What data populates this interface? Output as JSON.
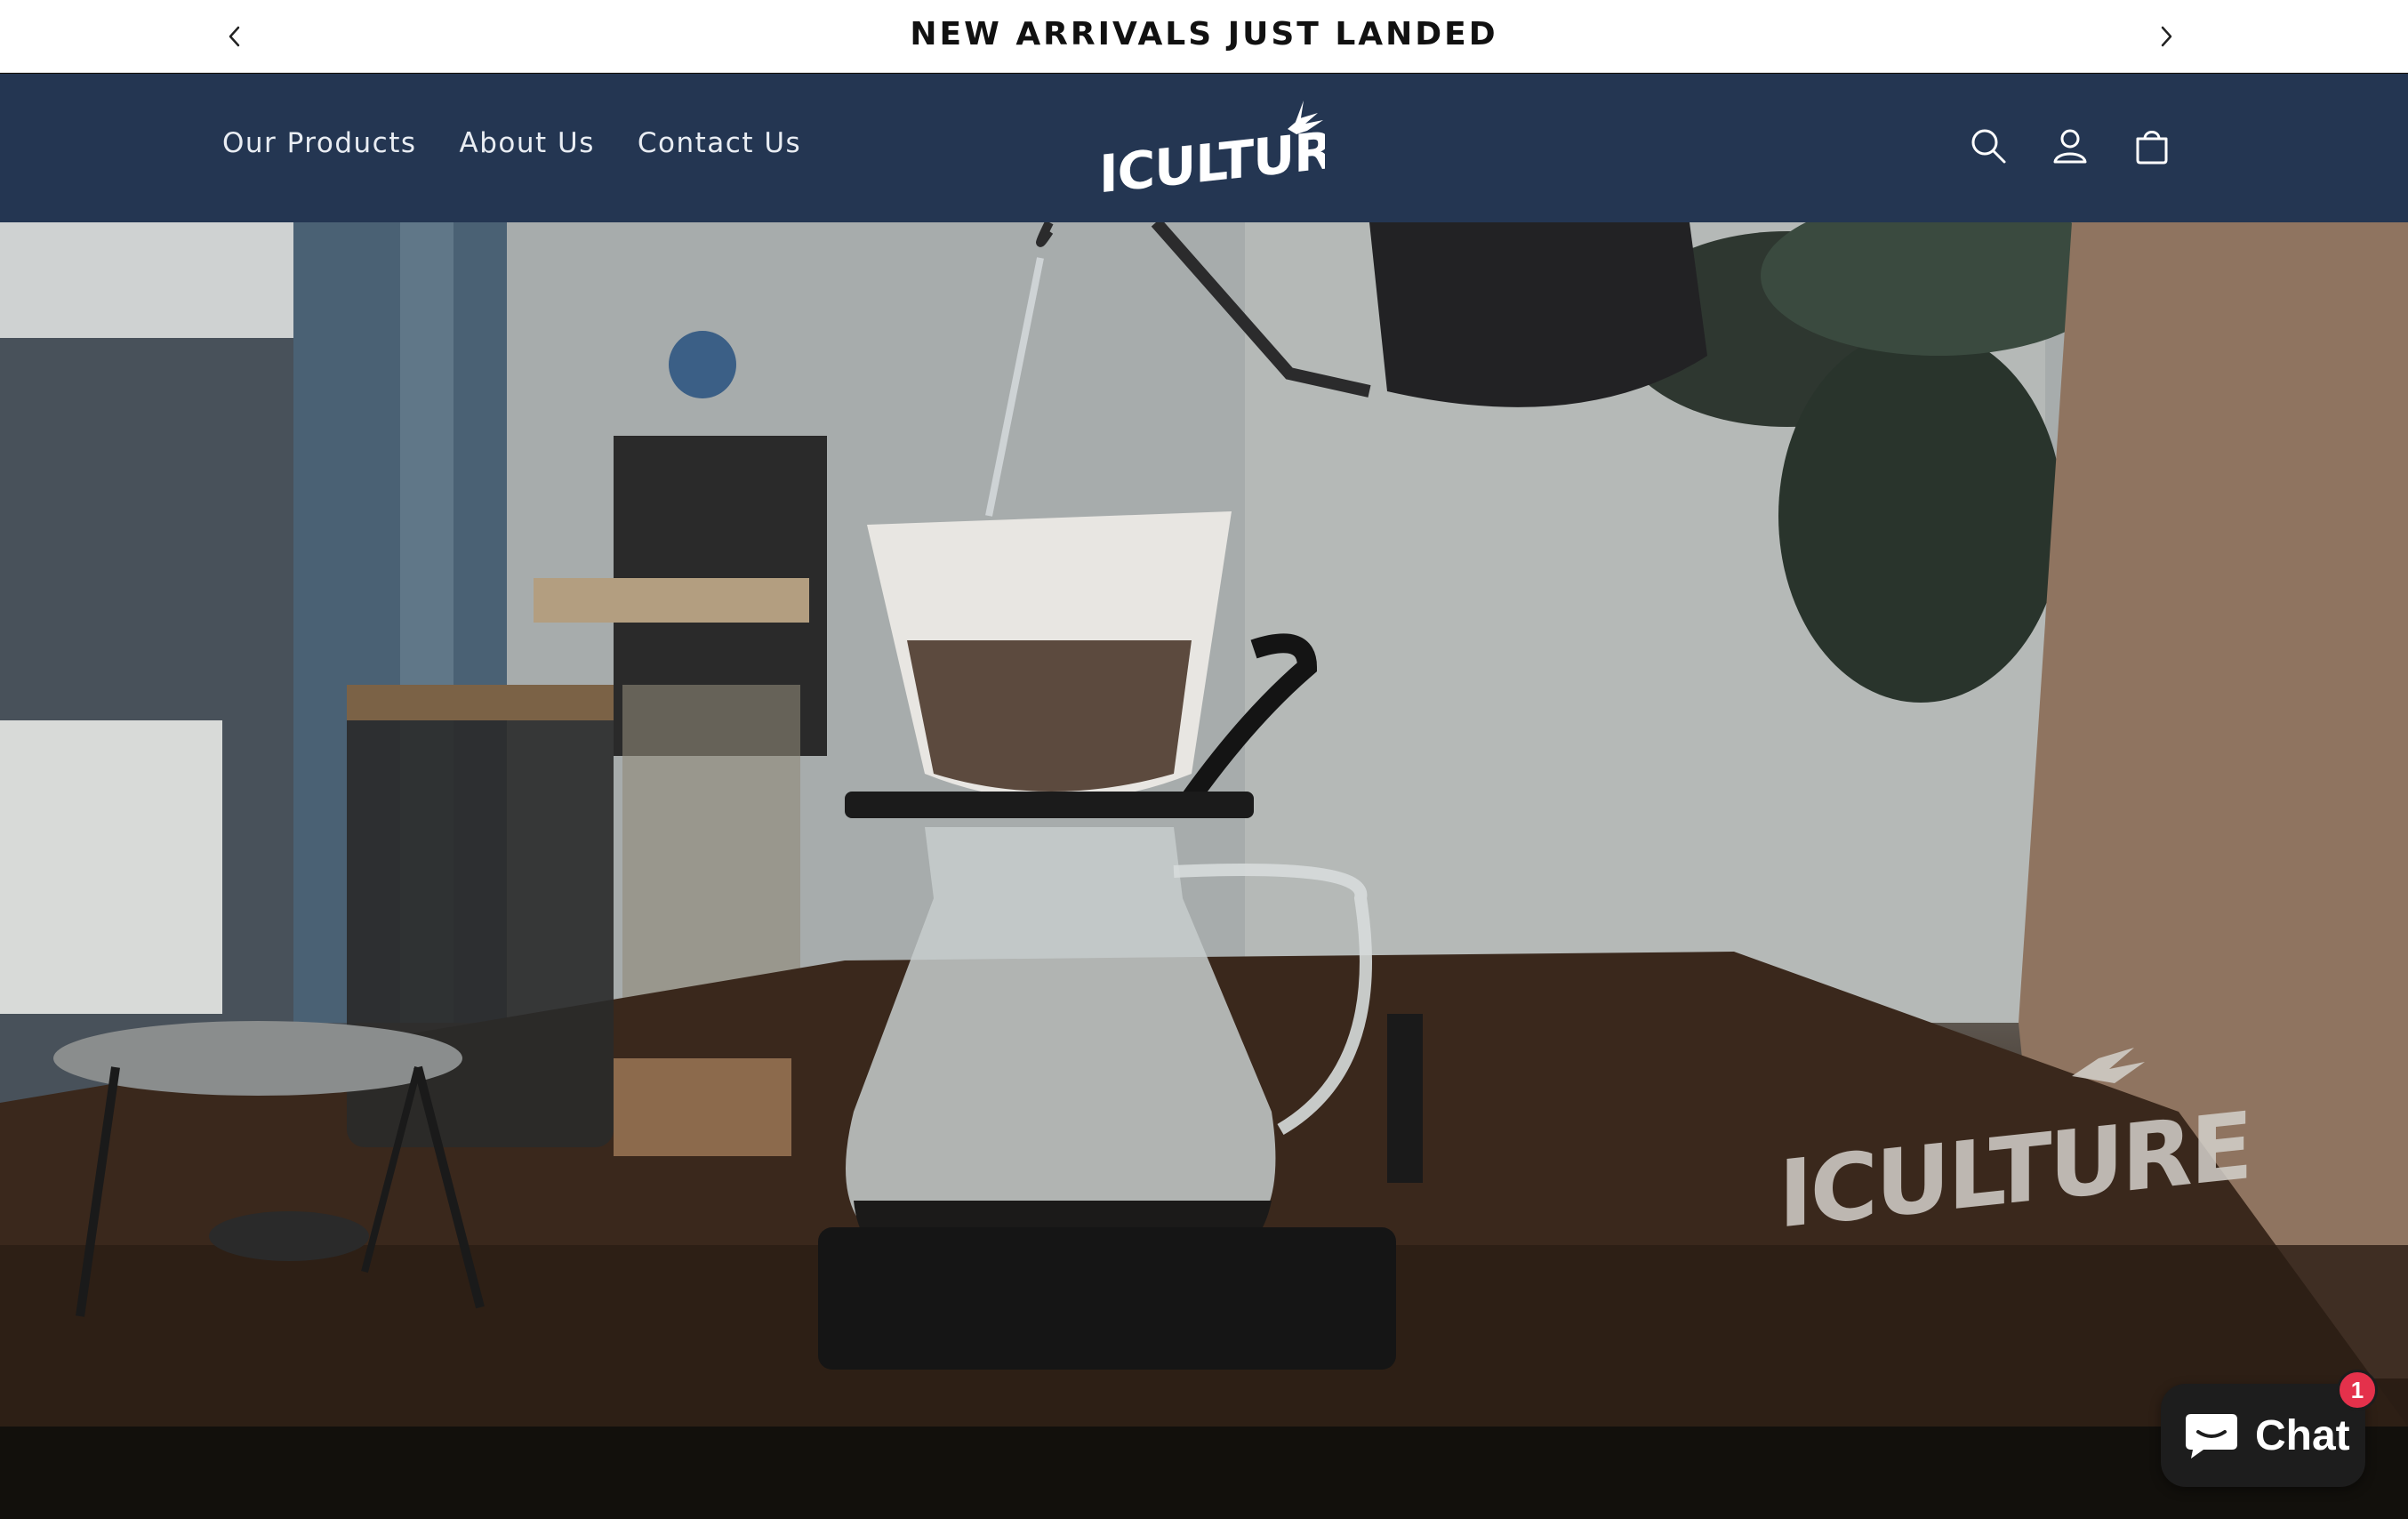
{
  "announcement": {
    "message": "NEW ARRIVALS JUST LANDED",
    "prev_icon": "chevron-left-icon",
    "next_icon": "chevron-right-icon"
  },
  "header": {
    "nav": [
      "Our Products",
      "About Us",
      "Contact Us"
    ],
    "logo_text": "ICULTURE",
    "icons": [
      "search-icon",
      "account-icon",
      "cart-icon"
    ],
    "background": "#243652"
  },
  "hero": {
    "watermark_text": "ICULTURE"
  },
  "chat": {
    "label": "Chat",
    "badge_count": "1"
  }
}
